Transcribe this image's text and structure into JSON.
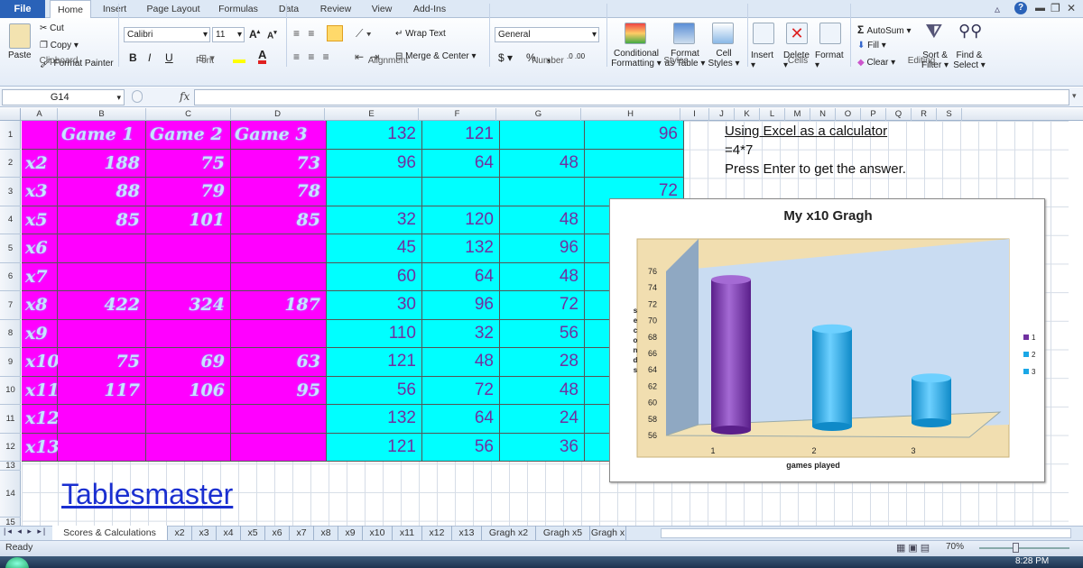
{
  "ribbon": {
    "file_tab": "File",
    "tabs": [
      "Home",
      "Insert",
      "Page Layout",
      "Formulas",
      "Data",
      "Review",
      "View",
      "Add-Ins"
    ],
    "clipboard": {
      "paste": "Paste",
      "cut": "Cut",
      "copy": "Copy",
      "format_painter": "Format Painter",
      "label": "Clipboard"
    },
    "font": {
      "name": "Calibri",
      "size": "11",
      "bold": "B",
      "italic": "I",
      "underline": "U",
      "label": "Font"
    },
    "alignment": {
      "wrap_text": "Wrap Text",
      "merge_center": "Merge & Center",
      "label": "Alignment"
    },
    "number": {
      "format": "General",
      "currency": "$",
      "percent": "%",
      "comma": ",",
      "inc_dec": ".0 .00",
      "label": "Number"
    },
    "styles": {
      "conditional_line1": "Conditional",
      "conditional_line2": "Formatting",
      "format_table_line1": "Format",
      "format_table_line2": "as Table",
      "cell_styles_line1": "Cell",
      "cell_styles_line2": "Styles",
      "label": "Styles"
    },
    "cells": {
      "insert": "Insert",
      "delete": "Delete",
      "format": "Format",
      "label": "Cells"
    },
    "editing": {
      "autosum": "AutoSum",
      "fill": "Fill",
      "clear": "Clear",
      "sort_line1": "Sort &",
      "sort_line2": "Filter",
      "find_line1": "Find &",
      "find_line2": "Select",
      "label": "Editing"
    }
  },
  "formula_bar": {
    "name_box": "G14",
    "fx": "fx",
    "value": ""
  },
  "columns": [
    "A",
    "B",
    "C",
    "D",
    "E",
    "F",
    "G",
    "H",
    "I",
    "J",
    "K",
    "L",
    "M",
    "N",
    "O",
    "P",
    "Q",
    "R",
    "S"
  ],
  "rows": [
    "1",
    "2",
    "3",
    "4",
    "5",
    "6",
    "7",
    "8",
    "9",
    "10",
    "11",
    "12",
    "13",
    "14",
    "15"
  ],
  "magenta_table": [
    [
      "",
      "Game 1",
      "Game 2",
      "Game 3"
    ],
    [
      "x2",
      "188",
      "75",
      "73"
    ],
    [
      "x3",
      "88",
      "79",
      "78"
    ],
    [
      "x5",
      "85",
      "101",
      "85"
    ],
    [
      "x6",
      "",
      "",
      ""
    ],
    [
      "x7",
      "",
      "",
      ""
    ],
    [
      "x8",
      "422",
      "324",
      "187"
    ],
    [
      "x9",
      "",
      "",
      ""
    ],
    [
      "x10",
      "75",
      "69",
      "63"
    ],
    [
      "x11",
      "117",
      "106",
      "95"
    ],
    [
      "x12",
      "",
      "",
      ""
    ],
    [
      "x13",
      "",
      "",
      ""
    ]
  ],
  "cyan_table": [
    [
      "132",
      "121",
      "",
      "96"
    ],
    [
      "96",
      "64",
      "48",
      ""
    ],
    [
      "",
      "",
      "",
      "72"
    ],
    [
      "32",
      "120",
      "48",
      ""
    ],
    [
      "45",
      "132",
      "96",
      ""
    ],
    [
      "60",
      "64",
      "48",
      ""
    ],
    [
      "30",
      "96",
      "72",
      ""
    ],
    [
      "110",
      "32",
      "56",
      ""
    ],
    [
      "121",
      "48",
      "28",
      ""
    ],
    [
      "56",
      "72",
      "48",
      ""
    ],
    [
      "132",
      "64",
      "24",
      ""
    ],
    [
      "121",
      "56",
      "36",
      ""
    ]
  ],
  "note": {
    "line1": "Using Excel as a calculator",
    "line2": "=4*7",
    "line3": "Press Enter to get the answer."
  },
  "link": "Tablesmaster",
  "chart_data": {
    "type": "bar",
    "title": "My x10 Gragh",
    "xlabel": "games played",
    "ylabel": "seconds",
    "categories": [
      "1",
      "2",
      "3"
    ],
    "values": [
      75,
      69,
      63
    ],
    "legend": [
      "1",
      "2",
      "3"
    ],
    "ylim": [
      56,
      76
    ],
    "yticks": [
      "76",
      "74",
      "72",
      "70",
      "68",
      "66",
      "64",
      "62",
      "60",
      "58",
      "56"
    ],
    "colors": [
      "#7030a0",
      "#1aa7e6",
      "#1aa7e6"
    ],
    "legend_position": "right"
  },
  "sheet_tabs": [
    "Scores & Calculations",
    "x2",
    "x3",
    "x4",
    "x5",
    "x6",
    "x7",
    "x8",
    "x9",
    "x10",
    "x11",
    "x12",
    "x13",
    "Gragh x2",
    "Gragh x5",
    "Gragh x"
  ],
  "status": {
    "ready": "Ready",
    "zoom": "70%",
    "time": "8:28 PM"
  }
}
